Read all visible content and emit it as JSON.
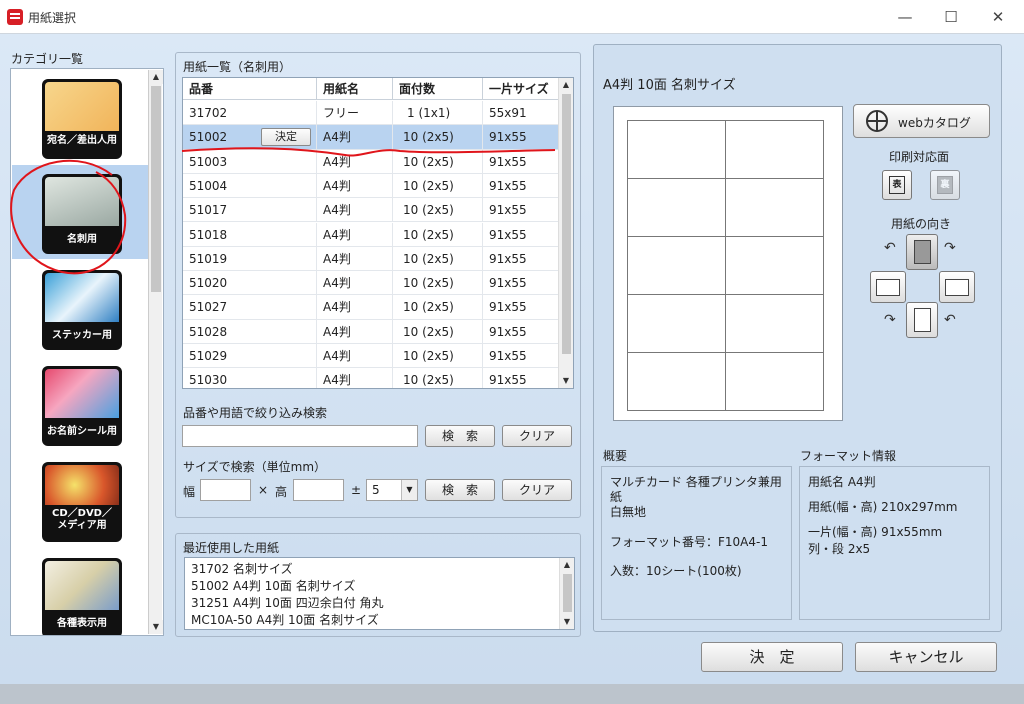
{
  "window": {
    "title": "用紙選択",
    "minimize": "—",
    "maximize": "☐",
    "close": "✕"
  },
  "categories": {
    "heading": "カテゴリ一覧",
    "items": [
      {
        "label": "宛名／差出人用",
        "selected": false
      },
      {
        "label": "名刺用",
        "selected": true
      },
      {
        "label": "ステッカー用",
        "selected": false
      },
      {
        "label": "お名前シール用",
        "selected": false
      },
      {
        "label": "CD／DVD／\nメディア用",
        "selected": false
      },
      {
        "label": "各種表示用",
        "selected": false
      }
    ]
  },
  "paper_list": {
    "heading": "用紙一覧（名刺用）",
    "columns": [
      "品番",
      "用紙名",
      "面付数",
      "一片サイズ"
    ],
    "rows": [
      {
        "id": "31702",
        "name": "フリー",
        "count": "1 (1x1)",
        "size": "55x91"
      },
      {
        "id": "51002",
        "name": "A4判",
        "count": "10 (2x5)",
        "size": "91x55",
        "selected": true
      },
      {
        "id": "51003",
        "name": "A4判",
        "count": "10 (2x5)",
        "size": "91x55"
      },
      {
        "id": "51004",
        "name": "A4判",
        "count": "10 (2x5)",
        "size": "91x55"
      },
      {
        "id": "51017",
        "name": "A4判",
        "count": "10 (2x5)",
        "size": "91x55"
      },
      {
        "id": "51018",
        "name": "A4判",
        "count": "10 (2x5)",
        "size": "91x55"
      },
      {
        "id": "51019",
        "name": "A4判",
        "count": "10 (2x5)",
        "size": "91x55"
      },
      {
        "id": "51020",
        "name": "A4判",
        "count": "10 (2x5)",
        "size": "91x55"
      },
      {
        "id": "51027",
        "name": "A4判",
        "count": "10 (2x5)",
        "size": "91x55"
      },
      {
        "id": "51028",
        "name": "A4判",
        "count": "10 (2x5)",
        "size": "91x55"
      },
      {
        "id": "51029",
        "name": "A4判",
        "count": "10 (2x5)",
        "size": "91x55"
      },
      {
        "id": "51030",
        "name": "A4判",
        "count": "10 (2x5)",
        "size": "91x55"
      }
    ],
    "row_button": "決定"
  },
  "keyword_search": {
    "label": "品番や用語で絞り込み検索",
    "value": "",
    "search_button": "検　索",
    "clear_button": "クリア"
  },
  "size_search": {
    "label": "サイズで検索（単位mm）",
    "width_label": "幅",
    "times": "×",
    "height_label": "高",
    "width_value": "",
    "height_value": "",
    "pm": "±",
    "tolerance": "5",
    "search_button": "検　索",
    "clear_button": "クリア"
  },
  "recent": {
    "heading": "最近使用した用紙",
    "items": [
      "31702 名刺サイズ",
      "51002 A4判 10面 名刺サイズ",
      "31251 A4判 10面 四辺余白付 角丸",
      "MC10A-50 A4判 10面 名刺サイズ"
    ]
  },
  "preview": {
    "title": "A4判 10面 名刺サイズ",
    "web_catalog": "webカタログ",
    "print_side_heading": "印刷対応面",
    "front": "表",
    "back": "裏",
    "orientation_heading": "用紙の向き"
  },
  "summary": {
    "heading": "概要",
    "lines": [
      "マルチカード 各種プリンタ兼用",
      "紙",
      "白無地",
      "",
      "フォーマット番号：F10A4-1",
      "",
      "入数：10シート(100枚)"
    ]
  },
  "format": {
    "heading": "フォーマット情報",
    "lines": [
      "用紙名 A4判",
      "用紙(幅・高) 210x297mm",
      "一片(幅・高) 91x55mm",
      "列・段 2x5"
    ]
  },
  "footer": {
    "ok": "決　定",
    "cancel": "キャンセル"
  },
  "colors": {
    "selection": "#b9d3f0",
    "annotation": "#e0151b",
    "brand": "#d71f26"
  }
}
